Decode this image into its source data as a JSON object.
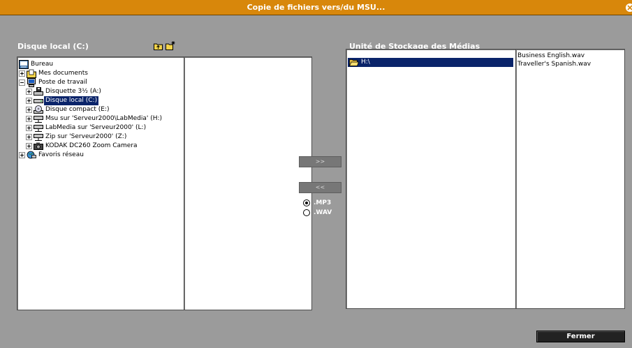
{
  "window": {
    "title": "Copie de fichiers vers/du MSU..."
  },
  "left": {
    "label": "Disque local (C:)",
    "tree": [
      {
        "label": "Bureau",
        "icon": "desktop-icon",
        "expander": "none",
        "level": 0
      },
      {
        "label": "Mes documents",
        "icon": "folder-documents-icon",
        "expander": "plus",
        "level": 1
      },
      {
        "label": "Poste de travail",
        "icon": "my-computer-icon",
        "expander": "minus",
        "level": 1
      },
      {
        "label": "Disquette 3½ (A:)",
        "icon": "floppy-drive-icon",
        "expander": "plus",
        "level": 2
      },
      {
        "label": "Disque local (C:)",
        "icon": "hard-drive-icon",
        "expander": "plus",
        "level": 2,
        "selected": true
      },
      {
        "label": "Disque compact (E:)",
        "icon": "cd-drive-icon",
        "expander": "plus",
        "level": 2
      },
      {
        "label": "Msu sur 'Serveur2000\\LabMedia' (H:)",
        "icon": "network-drive-icon",
        "expander": "plus",
        "level": 2
      },
      {
        "label": "LabMedia sur 'Serveur2000' (L:)",
        "icon": "network-drive-icon",
        "expander": "plus",
        "level": 2
      },
      {
        "label": "Zip sur 'Serveur2000' (Z:)",
        "icon": "network-drive-icon",
        "expander": "plus",
        "level": 2
      },
      {
        "label": "KODAK DC260 Zoom Camera",
        "icon": "camera-icon",
        "expander": "plus",
        "level": 2
      },
      {
        "label": "Favoris réseau",
        "icon": "network-places-icon",
        "expander": "plus",
        "level": 1
      }
    ]
  },
  "right": {
    "label": "Unité de Stockage des Médias",
    "folder": "H:\\",
    "files": [
      "Business English.wav",
      "Traveller's  Spanish.wav"
    ]
  },
  "transfer": {
    "copy_right_label": ">>",
    "copy_left_label": "<<"
  },
  "formats": [
    {
      "label": ".MP3",
      "selected": true
    },
    {
      "label": ".WAV",
      "selected": false
    }
  ],
  "footer": {
    "close_label": "Fermer"
  },
  "colors": {
    "titlebar": "#d8870b",
    "background": "#9b9b9b",
    "selection": "#0a246a"
  }
}
